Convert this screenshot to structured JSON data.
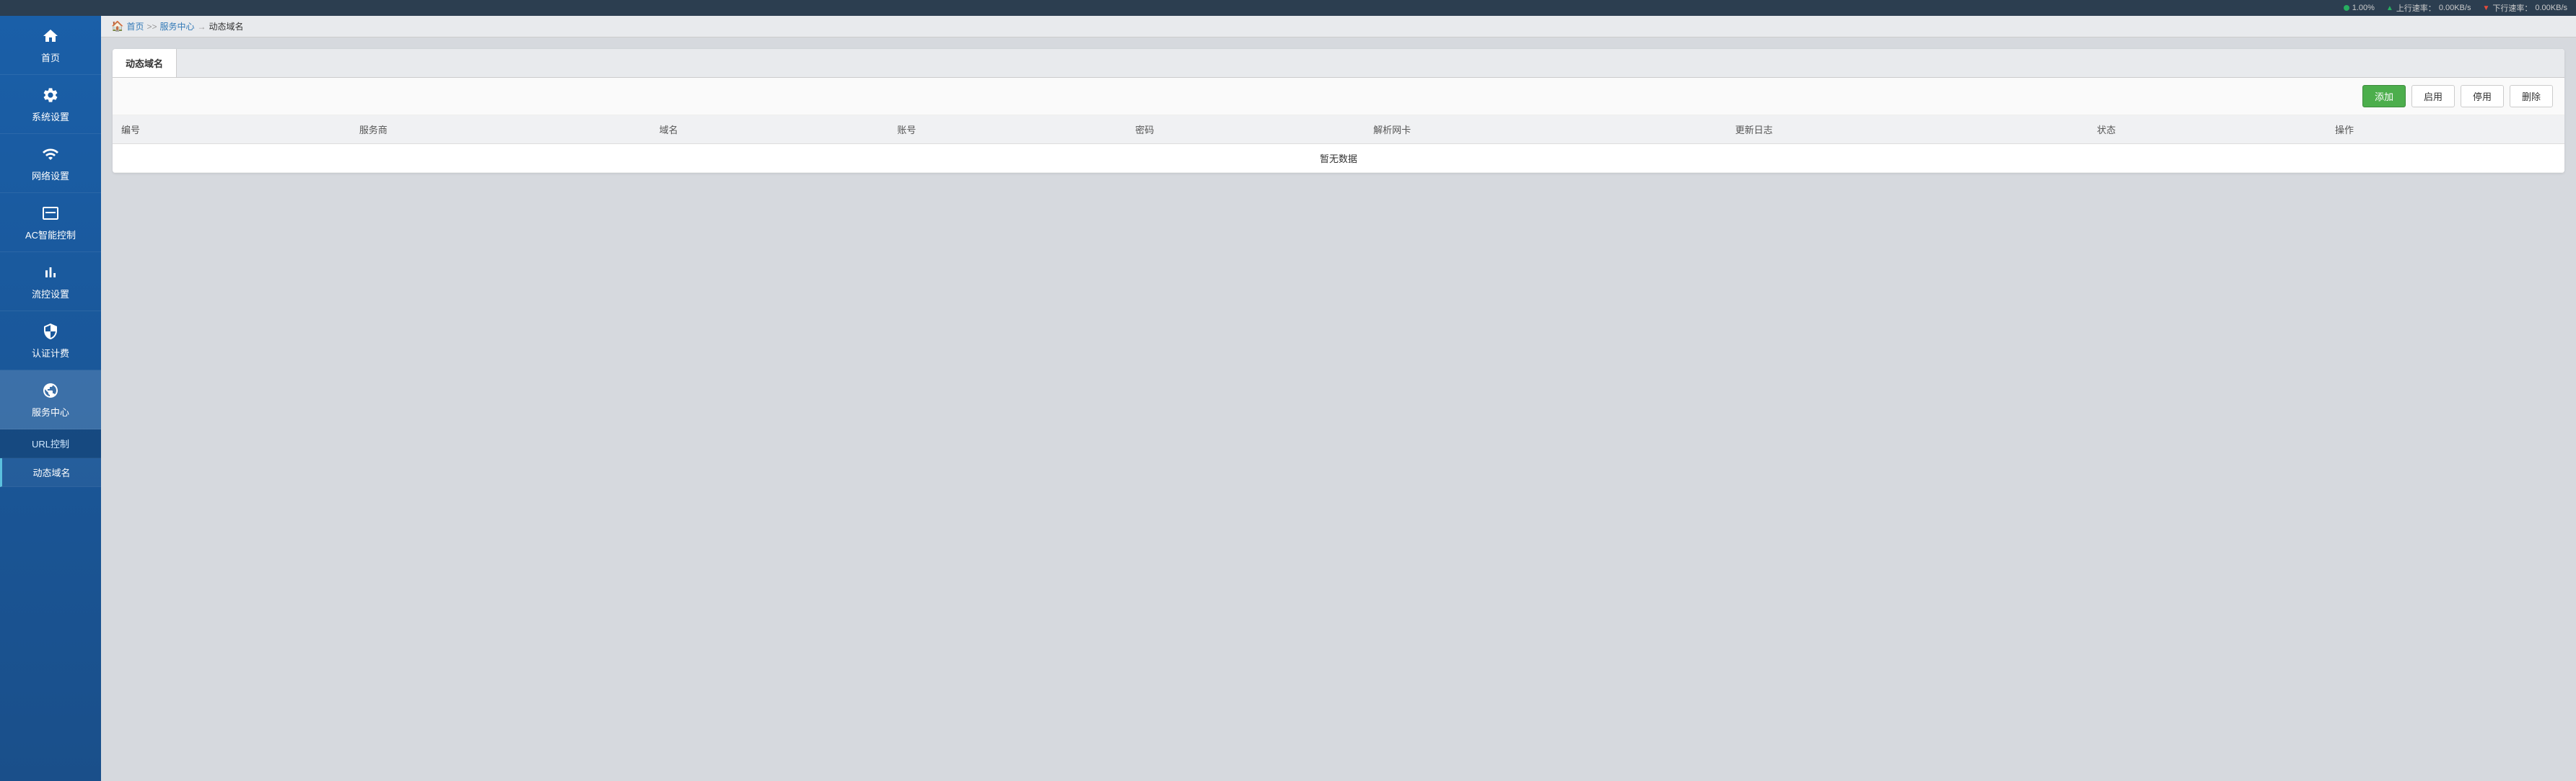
{
  "topbar": {
    "cpu_label": "1.00%",
    "upload_label": "上行速率：",
    "upload_value": "0.00KB/s",
    "download_label": "下行速率：",
    "download_value": "0.00KB/s"
  },
  "sidebar": {
    "items": [
      {
        "id": "home",
        "label": "首页",
        "icon": "home"
      },
      {
        "id": "system",
        "label": "系统设置",
        "icon": "settings"
      },
      {
        "id": "network",
        "label": "网络设置",
        "icon": "network"
      },
      {
        "id": "ac",
        "label": "AC智能控制",
        "icon": "ac"
      },
      {
        "id": "flow",
        "label": "流控设置",
        "icon": "flow"
      },
      {
        "id": "auth",
        "label": "认证计费",
        "icon": "auth"
      },
      {
        "id": "service",
        "label": "服务中心",
        "icon": "service",
        "active": true
      }
    ],
    "sub_items": [
      {
        "id": "url",
        "label": "URL控制"
      },
      {
        "id": "ddns",
        "label": "动态域名",
        "active": true
      },
      {
        "id": "other",
        "label": "..."
      }
    ]
  },
  "breadcrumb": {
    "home": "首页",
    "sep1": ">>",
    "service": "服务中心",
    "sep2": "→",
    "current": "动态域名"
  },
  "page": {
    "tab_label": "动态域名",
    "buttons": {
      "add": "添加",
      "enable": "启用",
      "disable": "停用",
      "delete": "删除"
    },
    "table": {
      "columns": [
        "编号",
        "服务商",
        "域名",
        "账号",
        "密码",
        "解析网卡",
        "更新日志",
        "状态",
        "操作"
      ],
      "empty_text": "暂无数据"
    }
  }
}
